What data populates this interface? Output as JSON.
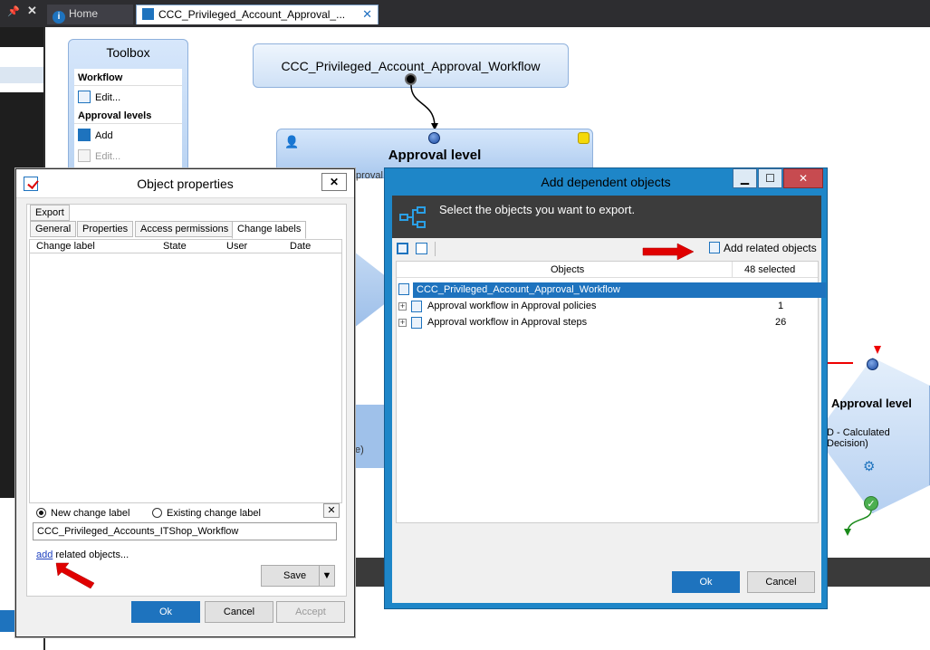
{
  "tabs": {
    "home": "Home",
    "workflow": "CCC_Privileged_Account_Approval_..."
  },
  "toolbox": {
    "title": "Toolbox",
    "sections": [
      {
        "heading": "Workflow",
        "items": [
          {
            "label": "Edit...",
            "enabled": true
          }
        ]
      },
      {
        "heading": "Approval levels",
        "items": [
          {
            "label": "Add",
            "enabled": true
          },
          {
            "label": "Edit...",
            "enabled": false
          }
        ]
      }
    ]
  },
  "canvas": {
    "root_node": "CCC_Privileged_Account_Approval_Workflow",
    "approval_level_title": "Approval level",
    "right_node_title": "Approval level",
    "right_node_subtitle": "D - Calculated Decision)",
    "left_fragment_1": "proval",
    "left_fragment_2": "e)"
  },
  "object_properties": {
    "title": "Object properties",
    "close_label": "✕",
    "tabs_row1": [
      "Export"
    ],
    "tabs_row2": [
      "General",
      "Properties",
      "Access permissions",
      "Change labels"
    ],
    "active_tab": "Change labels",
    "columns": [
      "Change label",
      "State",
      "User",
      "Date"
    ],
    "radio_new": "New change label",
    "radio_existing": "Existing change label",
    "change_label_value": "CCC_Privileged_Accounts_ITShop_Workflow",
    "add_link": "add",
    "add_link_suffix": " related objects...",
    "save_label": "Save",
    "ok_label": "Ok",
    "cancel_label": "Cancel",
    "accept_label": "Accept"
  },
  "add_dependent": {
    "title": "Add dependent objects",
    "header_text": "Select the objects you want to export.",
    "add_related_label": "Add related objects",
    "col_objects": "Objects",
    "col_selected": "48 selected",
    "rows": [
      {
        "label": "CCC_Privileged_Account_Approval_Workflow",
        "count": "",
        "selected": true,
        "expandable": false
      },
      {
        "label": "Approval workflow in Approval policies",
        "count": "1",
        "selected": false,
        "expandable": true
      },
      {
        "label": "Approval workflow in Approval steps",
        "count": "26",
        "selected": false,
        "expandable": true
      }
    ],
    "ok_label": "Ok",
    "cancel_label": "Cancel"
  },
  "colors": {
    "accent": "#1e73be",
    "arrow_red": "#e00000",
    "dialog_frame": "#1e86c8"
  }
}
